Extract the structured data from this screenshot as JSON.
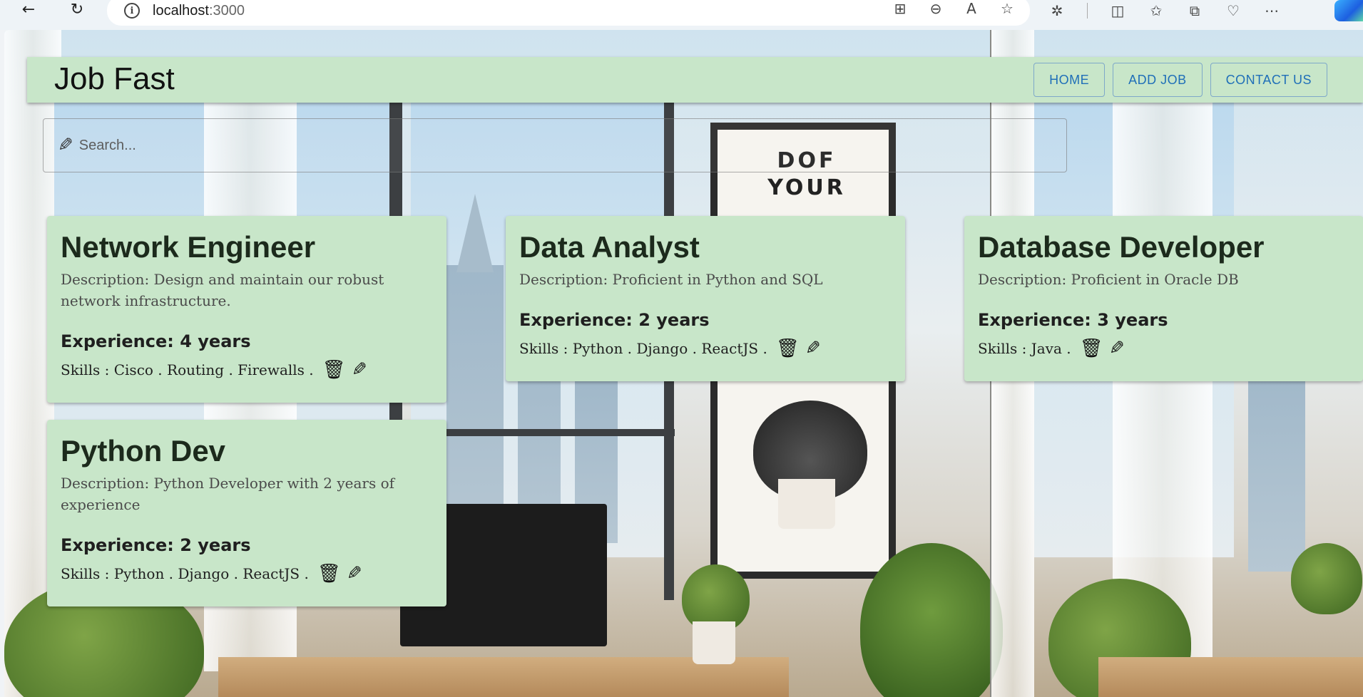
{
  "browser": {
    "url_host": "localhost",
    "url_port": ":3000",
    "back_icon": "arrow-left-icon",
    "refresh_icon": "refresh-icon"
  },
  "app": {
    "title": "Job Fast",
    "nav": [
      "HOME",
      "ADD JOB",
      "CONTACT US"
    ],
    "header_color": "#c8e6c9",
    "link_color": "#1f6fb8"
  },
  "search": {
    "placeholder": "Search..."
  },
  "background_poster": {
    "line1": "DOF",
    "line2": "YOUR"
  },
  "jobs": [
    {
      "title": "Network Engineer",
      "description": "Description: Design and maintain our robust network infrastructure.",
      "experience": "Experience: 4 years",
      "skills": "Skills : Cisco . Routing . Firewalls ."
    },
    {
      "title": "Data Analyst",
      "description": "Description: Proficient in Python and SQL",
      "experience": "Experience: 2 years",
      "skills": "Skills : Python . Django . ReactJS ."
    },
    {
      "title": "Database Developer",
      "description": "Description: Proficient in Oracle DB",
      "experience": "Experience: 3 years",
      "skills": "Skills : Java ."
    },
    {
      "title": "Python Dev",
      "description": "Description: Python Developer with 2 years of experience",
      "experience": "Experience: 2 years",
      "skills": "Skills : Python . Django . ReactJS ."
    }
  ]
}
